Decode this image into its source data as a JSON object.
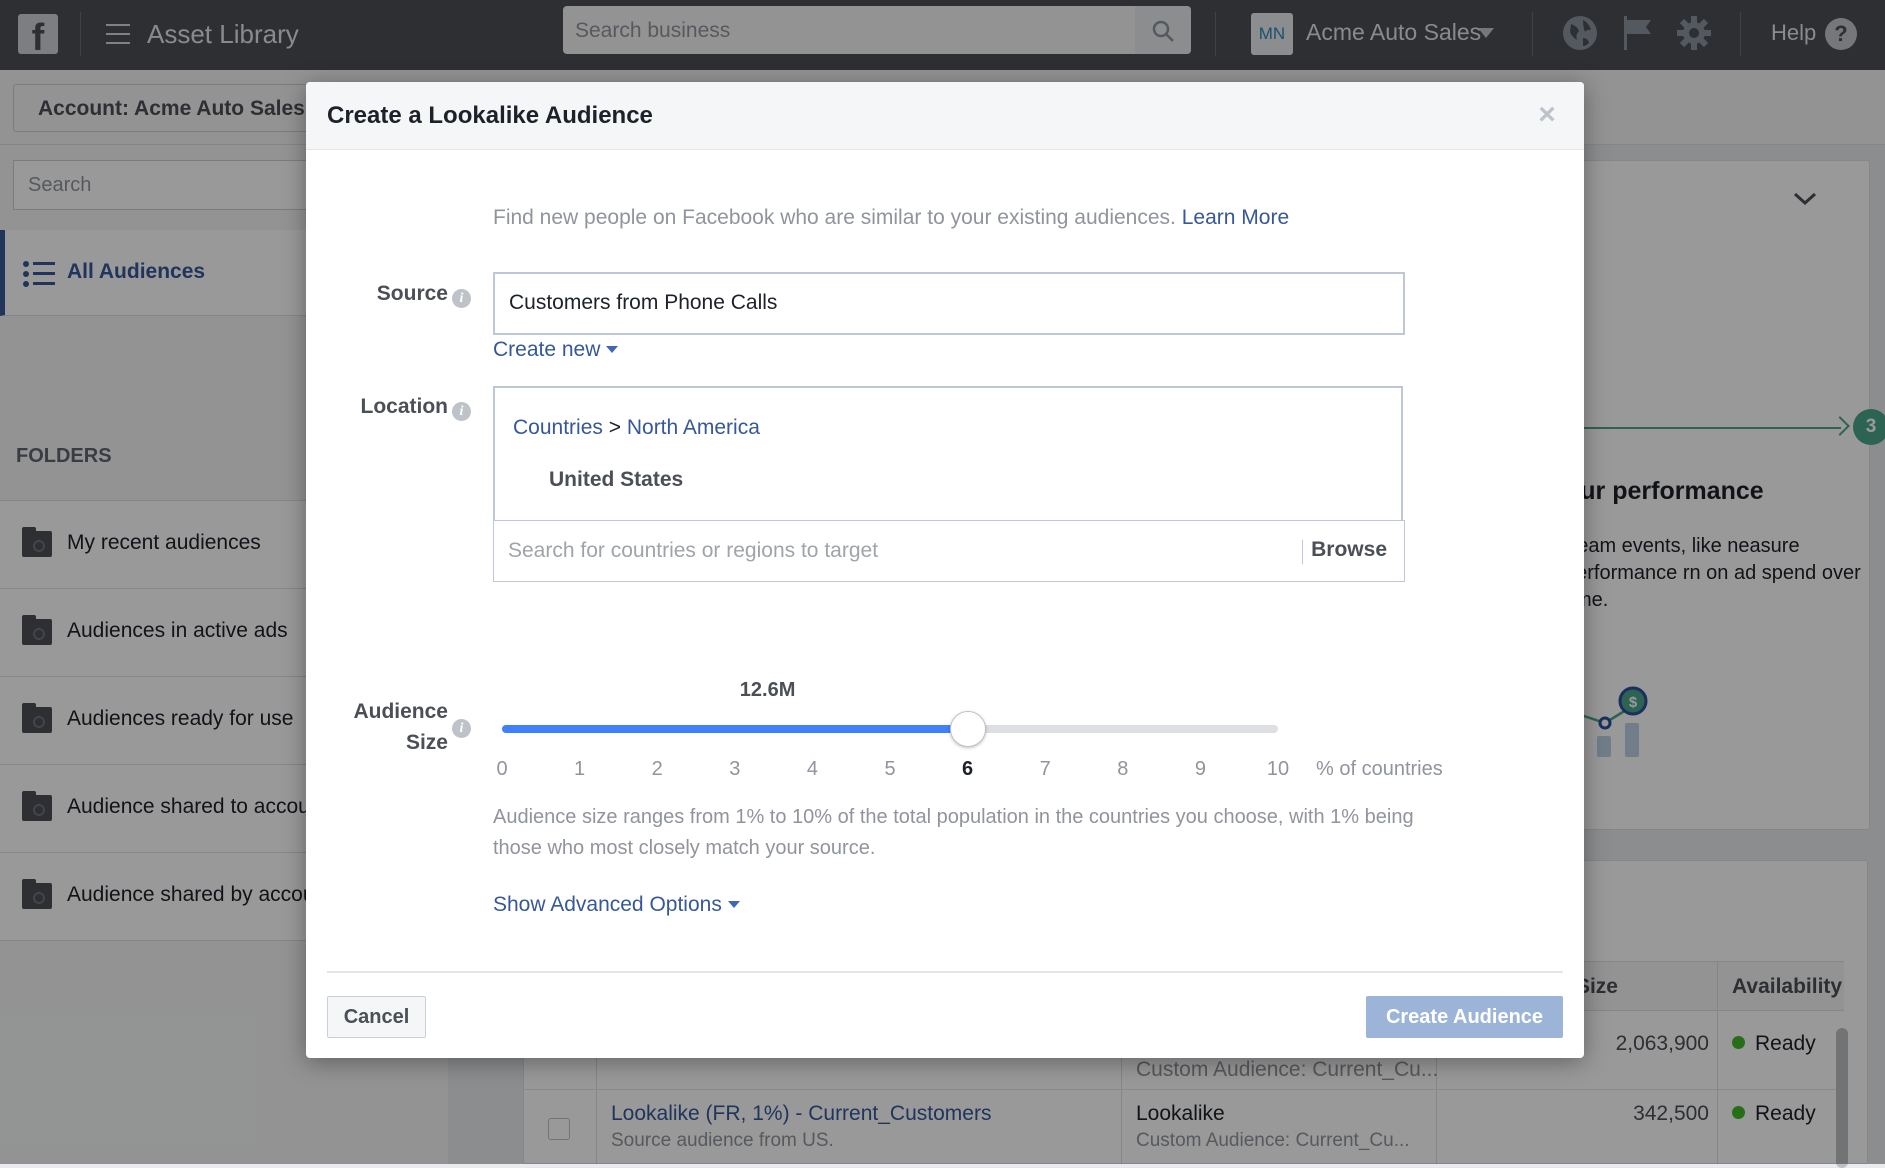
{
  "topbar": {
    "logo": "f",
    "app_title": "Asset Library",
    "search_placeholder": "Search business",
    "avatar_initials": "MN",
    "business_name": "Acme Auto Sales",
    "help_label": "Help",
    "help_icon": "?"
  },
  "account_bar": {
    "account_label": "Account: Acme Auto Sales"
  },
  "sidebar": {
    "search_placeholder": "Search",
    "all_audiences_label": "All Audiences",
    "folders_header": "FOLDERS",
    "folders": [
      {
        "label": "My recent audiences"
      },
      {
        "label": "Audiences in active ads"
      },
      {
        "label": "Audiences ready for use"
      },
      {
        "label": "Audience shared to accou"
      },
      {
        "label": "Audience shared by accou"
      }
    ]
  },
  "right_card": {
    "step_number": "3",
    "title": "our performance",
    "text": "tream events, like neasure performance rn on ad spend over time."
  },
  "table": {
    "columns": {
      "size": "Size",
      "availability": "Availability"
    },
    "rows": [
      {
        "name": "",
        "sub": "",
        "type": "",
        "type_sub": "Custom Audience: Current_Cu...",
        "size": "2,063,900",
        "availability": "Ready"
      },
      {
        "name": "Lookalike (FR, 1%) - Current_Customers",
        "sub": "Source audience from US.",
        "type": "Lookalike",
        "type_sub": "Custom Audience: Current_Cu...",
        "size": "342,500",
        "availability": "Ready"
      }
    ]
  },
  "modal": {
    "title": "Create a Lookalike Audience",
    "close_icon": "×",
    "intro_text": "Find new people on Facebook who are similar to your existing audiences.",
    "learn_more": "Learn More",
    "source": {
      "label": "Source",
      "value": "Customers from Phone Calls",
      "create_new": "Create new"
    },
    "location": {
      "label": "Location",
      "crumb_root": "Countries",
      "crumb_sep": ">",
      "crumb_region": "North America",
      "selected_country": "United States",
      "search_placeholder": "Search for countries or regions to target",
      "browse": "Browse"
    },
    "audience_size": {
      "label_line1": "Audience",
      "label_line2": "Size",
      "estimate": "12.6M",
      "value_percent": 6,
      "min": 0,
      "max": 10,
      "ticks": [
        "0",
        "1",
        "2",
        "3",
        "4",
        "5",
        "6",
        "7",
        "8",
        "9",
        "10"
      ],
      "unit_label": "% of countries",
      "note": "Audience size ranges from 1% to 10% of the total population in the countries you choose, with 1% being those who most closely match your source."
    },
    "advanced_options": "Show Advanced Options",
    "cancel_label": "Cancel",
    "create_label": "Create Audience"
  },
  "colors": {
    "brand_blue": "#365899",
    "slider_fill": "#4080ff",
    "create_disabled": "#9cb4d8",
    "ready_green": "#42b72a",
    "step_green": "#4aa58a"
  }
}
